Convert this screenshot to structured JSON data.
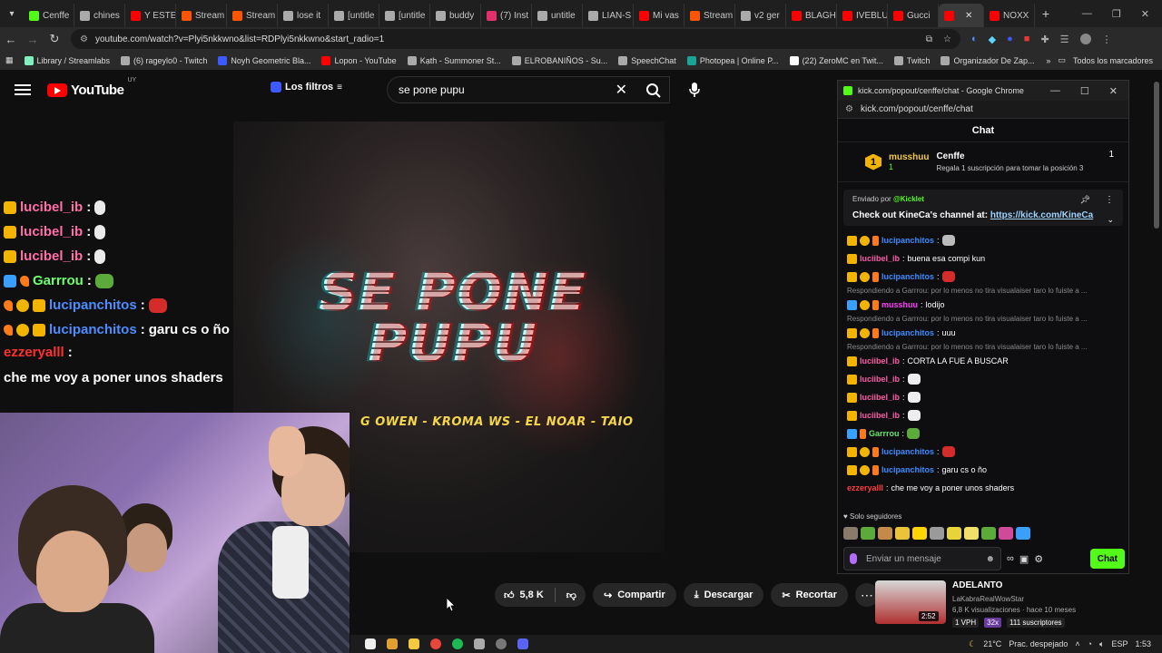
{
  "browser": {
    "tabs": [
      {
        "label": "Cenffe",
        "color": "#53fc18"
      },
      {
        "label": "chines",
        "color": "#aaaaaa"
      },
      {
        "label": "Y ESTE",
        "color": "#ff0000"
      },
      {
        "label": "Stream",
        "color": "#ff5500"
      },
      {
        "label": "Stream",
        "color": "#ff5500"
      },
      {
        "label": "lose it",
        "color": "#aaaaaa"
      },
      {
        "label": "[untitle",
        "color": "#aaaaaa"
      },
      {
        "label": "[untitle",
        "color": "#aaaaaa"
      },
      {
        "label": "buddy",
        "color": "#aaaaaa"
      },
      {
        "label": "(7) Inst",
        "color": "#e1306c"
      },
      {
        "label": "untitle",
        "color": "#aaaaaa"
      },
      {
        "label": "LIAN-S",
        "color": "#aaaaaa"
      },
      {
        "label": "Mi vas",
        "color": "#ff0000"
      },
      {
        "label": "Stream",
        "color": "#ff5500"
      },
      {
        "label": "v2 ger",
        "color": "#aaaaaa"
      },
      {
        "label": "BLAGH",
        "color": "#ff0000"
      },
      {
        "label": "IVEBLU",
        "color": "#ff0000"
      },
      {
        "label": "Gucci",
        "color": "#ff0000"
      },
      {
        "label": "",
        "color": "#ff0000",
        "active": true
      },
      {
        "label": "NOXX",
        "color": "#ff0000"
      }
    ],
    "url": "youtube.com/watch?v=Plyi5nkkwno&list=RDPlyi5nkkwno&start_radio=1",
    "bookmarks": [
      {
        "label": "Library / Streamlabs",
        "color": "#80f0c0"
      },
      {
        "label": "(6) rageylo0 - Twitch",
        "color": "#aaaaaa"
      },
      {
        "label": "Noyh Geometric Bla...",
        "color": "#3d5afe"
      },
      {
        "label": "Lopon - YouTube",
        "color": "#ff0000"
      },
      {
        "label": "Kạth - Summoner St...",
        "color": "#aaaaaa"
      },
      {
        "label": "ELROBANIÑOS - Su...",
        "color": "#aaaaaa"
      },
      {
        "label": "SpeechChat",
        "color": "#aaaaaa"
      },
      {
        "label": "Photopea | Online P...",
        "color": "#18a497"
      },
      {
        "label": "(22) ZeroMC en Twit...",
        "color": "#ffffff"
      },
      {
        "label": "Twitch",
        "color": "#aaaaaa"
      },
      {
        "label": "Organizador De Zap...",
        "color": "#aaaaaa"
      }
    ],
    "bookmarks_all": "Todos los marcadores"
  },
  "youtube": {
    "logo_text": "YouTube",
    "country": "UY",
    "filters_label": "Los filtros",
    "search_value": "se pone pupu",
    "video": {
      "title_art": "SE PONE PUPU",
      "artists": "G OWEN - KROMA WS - EL NOAR - TAIO"
    },
    "actions": {
      "likes": "5,8 K",
      "share": "Compartir",
      "download": "Descargar",
      "clip": "Recortar"
    },
    "recommendation": {
      "title": "ADELANTO",
      "channel": "LaKabraRealWowStar",
      "meta": "6,8 K visualizaciones · hace 10 meses",
      "duration": "2:52",
      "tag1": "1 VPH",
      "tag2": "32x",
      "tag3": "111 suscriptores"
    }
  },
  "overlay_chat": [
    {
      "user": "lucibel_ib",
      "color": "pink",
      "text": "",
      "emote": "white"
    },
    {
      "user": "lucibel_ib",
      "color": "pink",
      "text": "",
      "emote": "white"
    },
    {
      "user": "lucibel_ib",
      "color": "pink",
      "text": "",
      "emote": "white"
    },
    {
      "user": "Garrrou",
      "color": "green",
      "text": "",
      "emote": "frog"
    },
    {
      "user": "lucipanchitos",
      "color": "blue",
      "text": "",
      "emote": "straw"
    },
    {
      "user": "lucipanchitos",
      "color": "blue",
      "text": "garu cs o ño",
      "emote": ""
    },
    {
      "user": "ezzeryalll",
      "color": "red",
      "text": "che me voy a poner unos shaders",
      "emote": ""
    }
  ],
  "kick": {
    "window_title": "kick.com/popout/cenffe/chat - Google Chrome",
    "url": "kick.com/popout/cenffe/chat",
    "header": "Chat",
    "top_gifter": {
      "rank": "1",
      "name": "musshuu",
      "count": "1"
    },
    "channel": {
      "name": "Cenffe",
      "count": "1",
      "hint": "Regala 1 suscripción para tomar la posición 3"
    },
    "pinned": {
      "by_prefix": "Enviado por",
      "by_user": "@Kicklet",
      "text": "Check out KineCa's channel at:",
      "link": "https://kick.com/KineCa"
    },
    "messages": [
      {
        "type": "msg",
        "user": "lucipanchitos",
        "color": "n-blue",
        "text": "",
        "emote": "#bbbbbb"
      },
      {
        "type": "msg",
        "user": "luciibel_ib",
        "color": "n-pink",
        "text": "buena esa compi kun",
        "emote": ""
      },
      {
        "type": "msg",
        "user": "lucipanchitos",
        "color": "n-blue",
        "text": "",
        "emote": "#d42b2b"
      },
      {
        "type": "reply",
        "text": "Respondiendo a Garrrou: por lo menos no tira visualaiser taro lo fuiste a ..."
      },
      {
        "type": "msg",
        "user": "musshuu",
        "color": "n-mag",
        "text": "lodijo",
        "emote": ""
      },
      {
        "type": "reply",
        "text": "Respondiendo a Garrrou: por lo menos no tira visualaiser taro lo fuiste a ..."
      },
      {
        "type": "msg",
        "user": "lucipanchitos",
        "color": "n-blue",
        "text": "uuu",
        "emote": ""
      },
      {
        "type": "reply",
        "text": "Respondiendo a Garrrou: por lo menos no tira visualaiser taro lo fuiste a ..."
      },
      {
        "type": "msg",
        "user": "luciibel_ib",
        "color": "n-pink",
        "text": "CORTA LA FUE A BUSCAR",
        "emote": ""
      },
      {
        "type": "msg",
        "user": "luciibel_ib",
        "color": "n-pink",
        "text": "",
        "emote": "#eeeeee"
      },
      {
        "type": "msg",
        "user": "luciibel_ib",
        "color": "n-pink",
        "text": "",
        "emote": "#eeeeee"
      },
      {
        "type": "msg",
        "user": "luciibel_ib",
        "color": "n-pink",
        "text": "",
        "emote": "#eeeeee"
      },
      {
        "type": "msg",
        "user": "Garrrou",
        "color": "n-green",
        "text": "",
        "emote": "#5caa3a"
      },
      {
        "type": "msg",
        "user": "lucipanchitos",
        "color": "n-blue",
        "text": "",
        "emote": "#d42b2b"
      },
      {
        "type": "msg",
        "user": "lucipanchitos",
        "color": "n-blue",
        "text": "garu cs o ño",
        "emote": ""
      },
      {
        "type": "msg",
        "user": "ezzeryalll",
        "color": "n-red",
        "text": "che me voy a poner unos shaders",
        "emote": ""
      }
    ],
    "followers_only": "Solo seguidores",
    "input_placeholder": "Enviar un mensaje",
    "chat_button": "Chat"
  },
  "taskbar": {
    "weather": "21°C",
    "weather_text": "Prac. despejado",
    "lang": "ESP",
    "time": "1:53"
  }
}
